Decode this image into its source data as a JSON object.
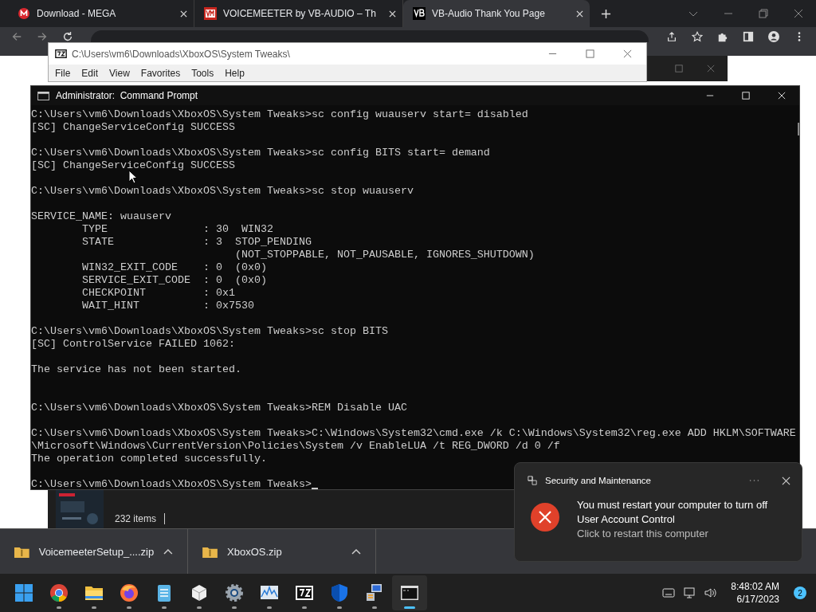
{
  "browser": {
    "tabs": [
      {
        "title": "Download - MEGA",
        "kind": "mega",
        "selected": false
      },
      {
        "title": "VOICEMEETER by VB-AUDIO – Th",
        "kind": "vm",
        "selected": false
      },
      {
        "title": "VB-Audio Thank You Page",
        "kind": "vb",
        "selected": true
      }
    ]
  },
  "archive_window": {
    "title": "C:\\Users\\vm6\\Downloads\\XboxOS\\System Tweaks\\",
    "menu": [
      "File",
      "Edit",
      "View",
      "Favorites",
      "Tools",
      "Help"
    ],
    "status": "232 items"
  },
  "console": {
    "title": "Administrator:  Command Prompt",
    "blocks": [
      {
        "spaced": false,
        "lines": [
          "C:\\Users\\vm6\\Downloads\\XboxOS\\System Tweaks>sc config wuauserv start= disabled",
          "[SC] ChangeServiceConfig SUCCESS"
        ]
      },
      {
        "spaced": false,
        "lines": [
          "C:\\Users\\vm6\\Downloads\\XboxOS\\System Tweaks>sc config BITS start= demand",
          "[SC] ChangeServiceConfig SUCCESS"
        ]
      },
      {
        "spaced": false,
        "lines": [
          "C:\\Users\\vm6\\Downloads\\XboxOS\\System Tweaks>sc stop wuauserv"
        ]
      },
      {
        "spaced": false,
        "lines": [
          "SERVICE_NAME: wuauserv",
          "        TYPE               : 30  WIN32",
          "        STATE              : 3  STOP_PENDING",
          "                                (NOT_STOPPABLE, NOT_PAUSABLE, IGNORES_SHUTDOWN)",
          "        WIN32_EXIT_CODE    : 0  (0x0)",
          "        SERVICE_EXIT_CODE  : 0  (0x0)",
          "        CHECKPOINT         : 0x1",
          "        WAIT_HINT          : 0x7530"
        ]
      },
      {
        "spaced": false,
        "lines": [
          "C:\\Users\\vm6\\Downloads\\XboxOS\\System Tweaks>sc stop BITS",
          "[SC] ControlService FAILED 1062:"
        ]
      },
      {
        "spaced": false,
        "lines": [
          "The service has not been started."
        ]
      },
      {
        "spaced": true,
        "lines": [
          "C:\\Users\\vm6\\Downloads\\XboxOS\\System Tweaks>REM Disable UAC"
        ]
      },
      {
        "spaced": false,
        "lines": [
          "C:\\Users\\vm6\\Downloads\\XboxOS\\System Tweaks>C:\\Windows\\System32\\cmd.exe /k C:\\Windows\\System32\\reg.exe ADD HKLM\\SOFTWARE",
          "\\Microsoft\\Windows\\CurrentVersion\\Policies\\System /v EnableLUA /t REG_DWORD /d 0 /f",
          "The operation completed successfully."
        ]
      },
      {
        "spaced": false,
        "lines": [
          "C:\\Users\\vm6\\Downloads\\XboxOS\\System Tweaks>"
        ],
        "cursor": true
      }
    ]
  },
  "downloads": [
    {
      "name": "VoicemeeterSetup_....zip"
    },
    {
      "name": "XboxOS.zip"
    }
  ],
  "notification": {
    "app": "Security and Maintenance",
    "message": "You must restart your computer to turn off User Account Control",
    "action": "Click to restart this computer"
  },
  "taskbar": {
    "apps": [
      {
        "kind": "start",
        "running": false,
        "active": false
      },
      {
        "kind": "chrome",
        "running": true,
        "active": false
      },
      {
        "kind": "folder",
        "running": true,
        "active": false
      },
      {
        "kind": "firefox",
        "running": true,
        "active": false
      },
      {
        "kind": "notepad",
        "running": true,
        "active": false
      },
      {
        "kind": "cube",
        "running": true,
        "active": false
      },
      {
        "kind": "gear",
        "running": true,
        "active": false
      },
      {
        "kind": "chart",
        "running": true,
        "active": false
      },
      {
        "kind": "archiver",
        "running": true,
        "active": false
      },
      {
        "kind": "shield",
        "running": true,
        "active": false
      },
      {
        "kind": "computer",
        "running": true,
        "active": false
      },
      {
        "kind": "terminal",
        "running": true,
        "active": true
      }
    ],
    "time": "8:48:02 AM",
    "date": "6/17/2023",
    "badge": "2"
  }
}
